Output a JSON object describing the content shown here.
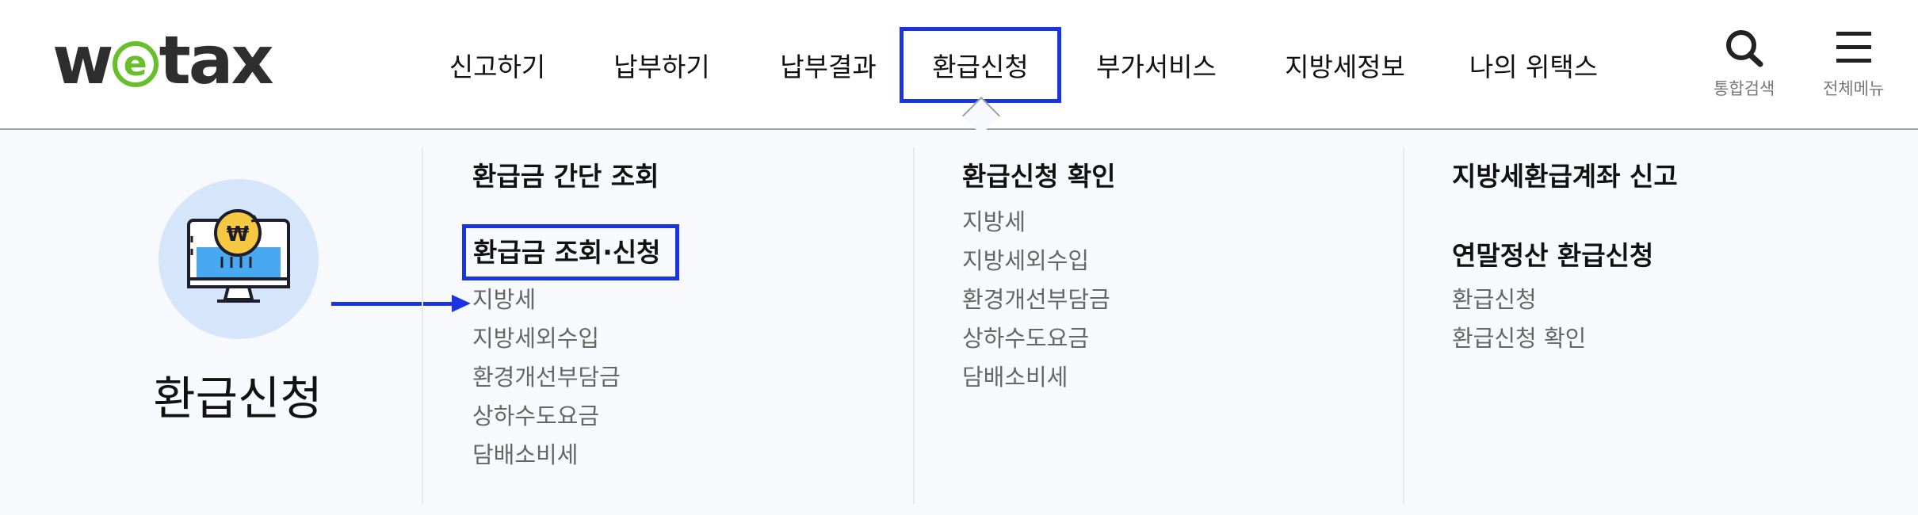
{
  "header": {
    "logo": {
      "w": "w",
      "e": "e",
      "tax": "tax"
    },
    "nav": [
      {
        "label": "신고하기"
      },
      {
        "label": "납부하기"
      },
      {
        "label": "납부결과"
      },
      {
        "label": "환급신청",
        "active": true
      },
      {
        "label": "부가서비스"
      },
      {
        "label": "지방세정보"
      },
      {
        "label": "나의 위택스"
      }
    ],
    "search": {
      "icon": "search-icon",
      "label": "통합검색"
    },
    "menu": {
      "icon": "hamburger-icon",
      "label": "전체메뉴"
    }
  },
  "panel": {
    "title": "환급신청",
    "icon": "refund-monitor-icon",
    "col1": {
      "heading1": "환급금 간단 조회",
      "heading2": "환급금 조회·신청",
      "items": [
        "지방세",
        "지방세외수입",
        "환경개선부담금",
        "상하수도요금",
        "담배소비세"
      ]
    },
    "col2": {
      "heading1": "환급신청 확인",
      "items": [
        "지방세",
        "지방세외수입",
        "환경개선부담금",
        "상하수도요금",
        "담배소비세"
      ]
    },
    "col3": {
      "heading1": "지방세환급계좌 신고",
      "heading2": "연말정산 환급신청",
      "items": [
        "환급신청",
        "환급신청 확인"
      ]
    }
  },
  "colors": {
    "accent": "#1a35e0",
    "logo_green": "#67c02a",
    "panel_bg": "#f7f9fc",
    "badge_bg": "#d6e6fa"
  }
}
